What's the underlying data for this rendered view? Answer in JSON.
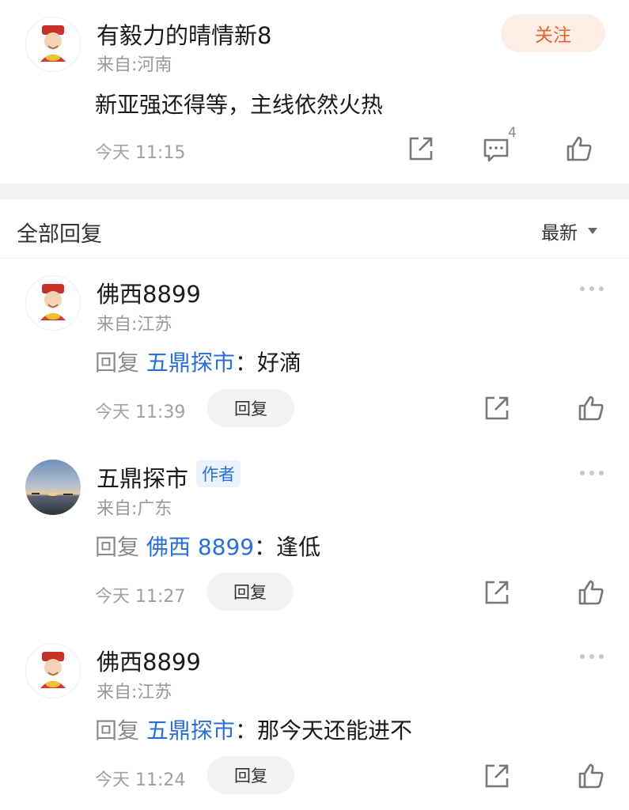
{
  "post": {
    "username": "有毅力的晴情新8",
    "location": "来自:河南",
    "follow_label": "关注",
    "content": "新亚强还得等，主线依然火热",
    "time": "今天 11:15",
    "comment_count": "4"
  },
  "replies_header": {
    "title": "全部回复",
    "sort_label": "最新"
  },
  "replies": [
    {
      "username": "佛西8899",
      "location": "来自:江苏",
      "reply_prefix": "回复",
      "mention": "五鼎探市",
      "separator": "：",
      "text": "好滴",
      "time": "今天 11:39",
      "reply_label": "回复"
    },
    {
      "username": "五鼎探市",
      "author_badge": "作者",
      "location": "来自:广东",
      "reply_prefix": "回复",
      "mention": "佛西 8899",
      "separator": "：",
      "text": "逢低",
      "time": "今天 11:27",
      "reply_label": "回复"
    },
    {
      "username": "佛西8899",
      "location": "来自:江苏",
      "reply_prefix": "回复",
      "mention": "五鼎探市",
      "separator": "：",
      "text": "那今天还能进不",
      "time": "今天 11:24",
      "reply_label": "回复"
    }
  ],
  "colors": {
    "accent_follow_bg": "#fdeee6",
    "accent_follow_text": "#e8622a",
    "mention": "#2a6fd6",
    "divider": "#f4f4f4"
  },
  "icons": [
    "share-icon",
    "comment-icon",
    "like-icon",
    "more-icon",
    "dropdown-caret-icon"
  ]
}
